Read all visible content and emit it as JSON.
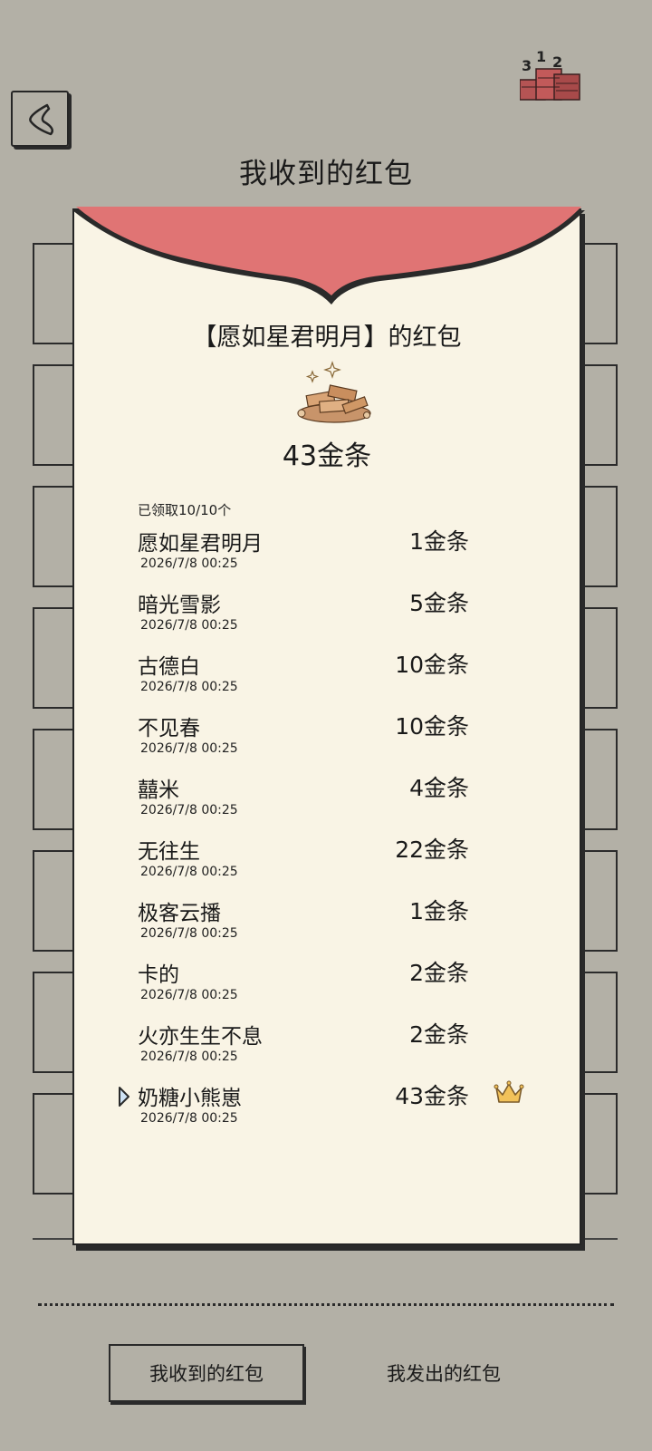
{
  "header": {
    "title": "我收到的红包",
    "back_icon": "back-arrow-icon",
    "rank_icon": "podium-gold-icon"
  },
  "modal": {
    "sender": "【愿如星君明月】的红包",
    "total": "43金条",
    "claimed": "已领取10/10个",
    "colors": {
      "flap": "#e07474",
      "paper": "#f9f4e5"
    },
    "recipients": [
      {
        "name": "愿如星君明月",
        "time": "2026/7/8 00:25",
        "amount": "1金条"
      },
      {
        "name": "暗光雪影",
        "time": "2026/7/8 00:25",
        "amount": "5金条"
      },
      {
        "name": "古德白",
        "time": "2026/7/8 00:25",
        "amount": "10金条"
      },
      {
        "name": "不见春",
        "time": "2026/7/8 00:25",
        "amount": "10金条"
      },
      {
        "name": "囍米",
        "time": "2026/7/8 00:25",
        "amount": "4金条"
      },
      {
        "name": "无往生",
        "time": "2026/7/8 00:25",
        "amount": "22金条"
      },
      {
        "name": "极客云播",
        "time": "2026/7/8 00:25",
        "amount": "1金条"
      },
      {
        "name": "卡的",
        "time": "2026/7/8 00:25",
        "amount": "2金条"
      },
      {
        "name": "火亦生生不息",
        "time": "2026/7/8 00:25",
        "amount": "2金条"
      },
      {
        "name": "奶糖小熊崽",
        "time": "2026/7/8 00:25",
        "amount": "43金条",
        "self": true,
        "best": true
      }
    ]
  },
  "tabs": {
    "received": "我收到的红包",
    "sent": "我发出的红包",
    "active": "received"
  }
}
